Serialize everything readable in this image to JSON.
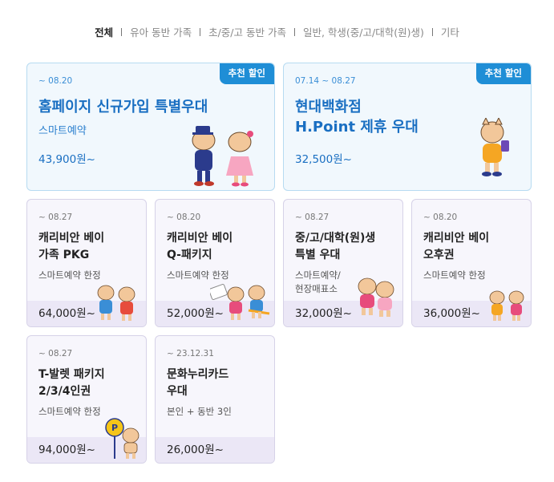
{
  "tabs": [
    {
      "label": "전체",
      "active": true
    },
    {
      "label": "유아 동반 가족",
      "active": false
    },
    {
      "label": "초/중/고 동반 가족",
      "active": false
    },
    {
      "label": "일반, 학생(중/고/대학(원)생)",
      "active": false
    },
    {
      "label": "기타",
      "active": false
    }
  ],
  "badge": "추천 할인",
  "cards": [
    {
      "date": "~ 08.20",
      "title": "홈페이지 신규가입 특별우대",
      "sub": "스마트예약",
      "price": "43,900원~"
    },
    {
      "date": "07.14 ~ 08.27",
      "title": "현대백화점\nH.Point 제휴 우대",
      "sub": "",
      "price": "32,500원~"
    },
    {
      "date": "~ 08.27",
      "title": "캐리비안 베이\n가족 PKG",
      "sub": "스마트예약 한정",
      "price": "64,000원~"
    },
    {
      "date": "~ 08.20",
      "title": "캐리비안 베이\nQ-패키지",
      "sub": "스마트예약 한정",
      "price": "52,000원~"
    },
    {
      "date": "~ 08.27",
      "title": "중/고/대학(원)생\n특별 우대",
      "sub": "스마트예약/\n현장매표소",
      "price": "32,000원~"
    },
    {
      "date": "~ 08.20",
      "title": "캐리비안 베이\n오후권",
      "sub": "스마트예약 한정",
      "price": "36,000원~"
    },
    {
      "date": "~ 08.27",
      "title": "T-발렛 패키지\n2/3/4인권",
      "sub": "스마트예약 한정",
      "price": "94,000원~"
    },
    {
      "date": "~ 23.12.31",
      "title": "문화누리카드\n우대",
      "sub": "본인 + 동반 3인",
      "price": "26,000원~"
    }
  ],
  "colors": {
    "accent": "#1f8ed6",
    "title_blue": "#1a6fc2",
    "card_blue_bg": "#f1f8fd",
    "card_purple_band": "#ebe7f6"
  }
}
